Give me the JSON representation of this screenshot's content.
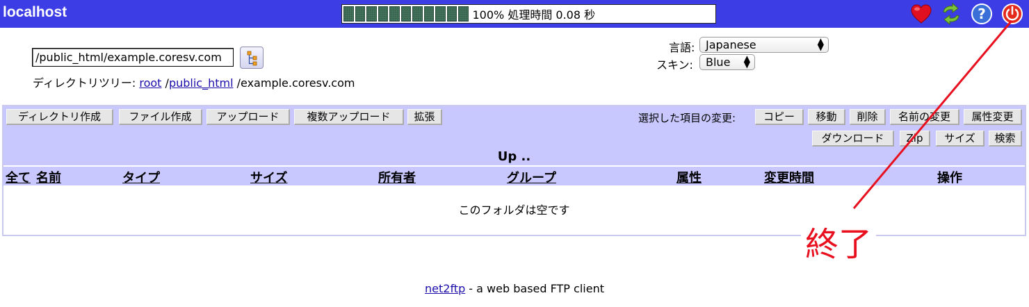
{
  "topbar": {
    "host": "localhost",
    "progress_text": "100% 処理時間 0.08 秒",
    "progress_fraction": 1.0,
    "icons": [
      "bookmark-heart-icon",
      "refresh-icon",
      "help-icon",
      "logout-power-icon"
    ],
    "bar_color": "#3d3de6"
  },
  "path": {
    "value": "/public_html/example.coresv.com",
    "breadcrumb_label": "ディレクトリツリー:",
    "crumb_root": "root",
    "crumb_sep1": "/",
    "crumb_public": "public_html",
    "crumb_rest": "/example.coresv.com"
  },
  "settings": {
    "lang_label": "言語:",
    "lang_value": "Japanese",
    "skin_label": "スキン:",
    "skin_value": "Blue"
  },
  "toolbar": {
    "left_buttons": [
      "ディレクトリ作成",
      "ファイル作成",
      "アップロード",
      "複数アップロード",
      "拡張"
    ],
    "selected_label": "選択した項目の変更:",
    "right_buttons_row1": [
      "コピー",
      "移動",
      "削除",
      "名前の変更",
      "属性変更"
    ],
    "right_buttons_row2": [
      "ダウンロード",
      "Zip",
      "サイズ",
      "検索"
    ]
  },
  "listing": {
    "up": "Up ..",
    "columns": [
      "全て",
      "名前",
      "タイプ",
      "サイズ",
      "所有者",
      "グループ",
      "属性",
      "変更時間",
      "操作"
    ],
    "empty_message": "このフォルダは空です"
  },
  "footer": {
    "link": "net2ftp",
    "text": " - a web based FTP client"
  },
  "annotation": {
    "text": "終了",
    "color": "#e8101e"
  }
}
